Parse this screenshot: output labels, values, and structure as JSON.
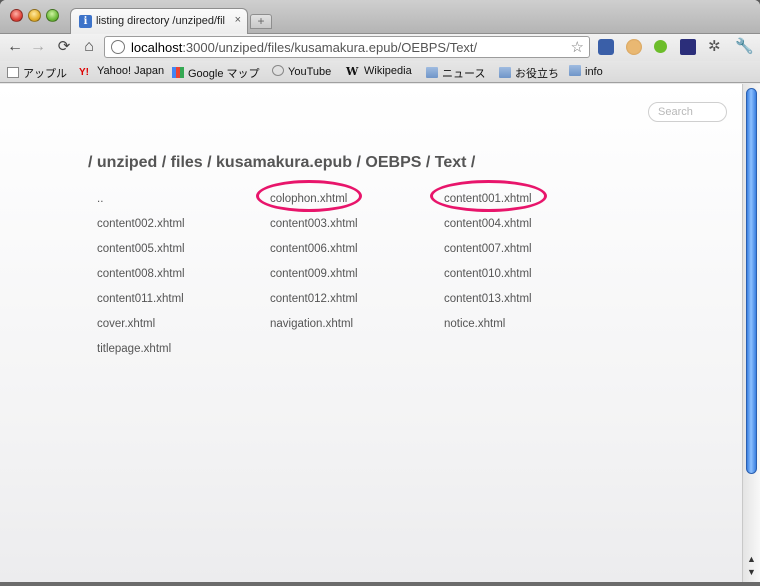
{
  "tab": {
    "title": "listing directory /unziped/fil",
    "close": "×",
    "new_tab": "+"
  },
  "toolbar": {
    "back": "←",
    "forward": "→",
    "reload": "⟳",
    "home": "⌂",
    "url_host": "localhost",
    "url_rest": ":3000/unziped/files/kusamakura.epub/OEBPS/Text/",
    "star": "☆",
    "gear": "✲",
    "wrench": "🔧"
  },
  "bookmarks": [
    {
      "label": "アップル",
      "icon": "apple-icon"
    },
    {
      "label": "Yahoo! Japan",
      "icon": "yahoo-icon"
    },
    {
      "label": "Google マップ",
      "icon": "google-maps-icon"
    },
    {
      "label": "YouTube",
      "icon": "youtube-icon"
    },
    {
      "label": "Wikipedia",
      "icon": "wikipedia-icon"
    },
    {
      "label": "ニュース",
      "icon": "folder-icon"
    },
    {
      "label": "お役立ち",
      "icon": "folder-icon"
    },
    {
      "label": "info",
      "icon": "folder-icon"
    }
  ],
  "page": {
    "search_placeholder": "Search",
    "heading": "/ unziped / files / kusamakura.epub / OEBPS / Text /",
    "files": [
      "..",
      "colophon.xhtml",
      "content001.xhtml",
      "content002.xhtml",
      "content003.xhtml",
      "content004.xhtml",
      "content005.xhtml",
      "content006.xhtml",
      "content007.xhtml",
      "content008.xhtml",
      "content009.xhtml",
      "content010.xhtml",
      "content011.xhtml",
      "content012.xhtml",
      "content013.xhtml",
      "cover.xhtml",
      "navigation.xhtml",
      "notice.xhtml",
      "titlepage.xhtml"
    ],
    "highlight_color": "#e8156b"
  }
}
